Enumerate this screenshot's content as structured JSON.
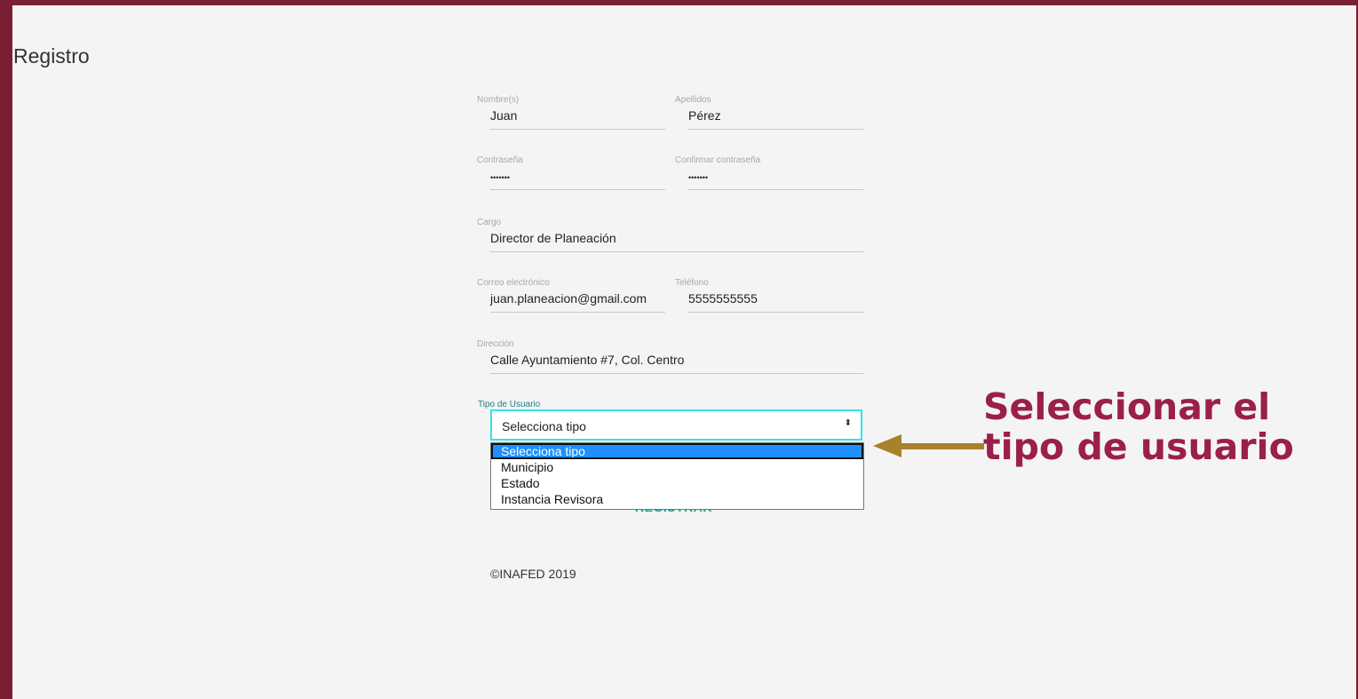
{
  "page": {
    "title": "Registro"
  },
  "fields": {
    "nombre": {
      "label": "Nombre(s)",
      "value": "Juan"
    },
    "apellidos": {
      "label": "Apellidos",
      "value": "Pérez"
    },
    "contrasena": {
      "label": "Contraseña",
      "value": "•••••••"
    },
    "confirmar": {
      "label": "Confirmar contraseña",
      "value": "•••••••"
    },
    "cargo": {
      "label": "Cargo",
      "value": "Director de Planeación"
    },
    "correo": {
      "label": "Correo electrónico",
      "value": "juan.planeacion@gmail.com"
    },
    "telefono": {
      "label": "Teléfono",
      "value": "5555555555"
    },
    "direccion": {
      "label": "Dirección",
      "value": "Calle Ayuntamiento #7, Col. Centro"
    }
  },
  "user_type": {
    "label": "Tipo de Usuario",
    "selected": "Selecciona tipo",
    "options": [
      "Selecciona tipo",
      "Municipio",
      "Estado",
      "Instancia Revisora"
    ]
  },
  "actions": {
    "register_label": "REGISTRAR"
  },
  "footer": {
    "text": "©INAFED 2019"
  },
  "annotation": {
    "line1": "Seleccionar el",
    "line2": "tipo de usuario"
  },
  "colors": {
    "frame": "#7a1e32",
    "accent_teal": "#1a9e8f",
    "select_focus": "#2ee8e3",
    "option_highlight": "#1e90ff",
    "callout": "#9b1f4b",
    "arrow": "#a8822a"
  },
  "icons": {
    "select_caret": "updown-caret-icon",
    "annotation_arrow": "left-arrow-icon"
  }
}
